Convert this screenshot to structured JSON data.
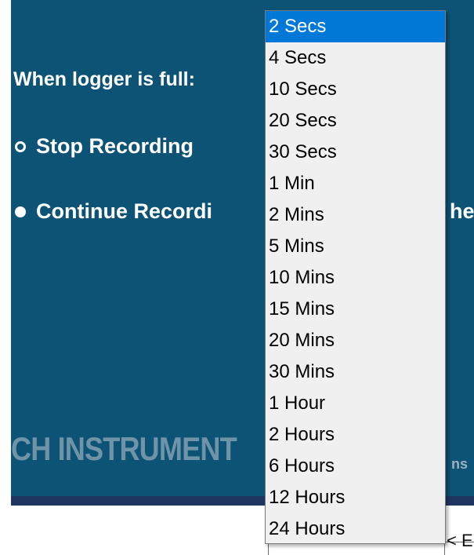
{
  "window": {
    "background_color": "#0d5376",
    "bar_color": "#1f3660"
  },
  "settings": {
    "full_label": "When logger is full:",
    "options": [
      {
        "label": "Stop Recording",
        "state": "unselected"
      },
      {
        "label": "Continue Recordi",
        "state": "selected"
      }
    ],
    "partial_right": "he"
  },
  "branding": {
    "left_text": "CH INSTRUMENT",
    "right_text": "ns"
  },
  "dropdown": {
    "selected_index": 0,
    "options": [
      "2 Secs",
      "4 Secs",
      "10 Secs",
      "20 Secs",
      "30 Secs",
      "1 Min",
      "2 Mins",
      "5 Mins",
      "10 Mins",
      "15 Mins",
      "20 Mins",
      "30 Mins",
      "1 Hour",
      "2 Hours",
      "6 Hours",
      "12 Hours",
      "24 Hours"
    ]
  },
  "bottom": {
    "partial_text": "< E"
  }
}
